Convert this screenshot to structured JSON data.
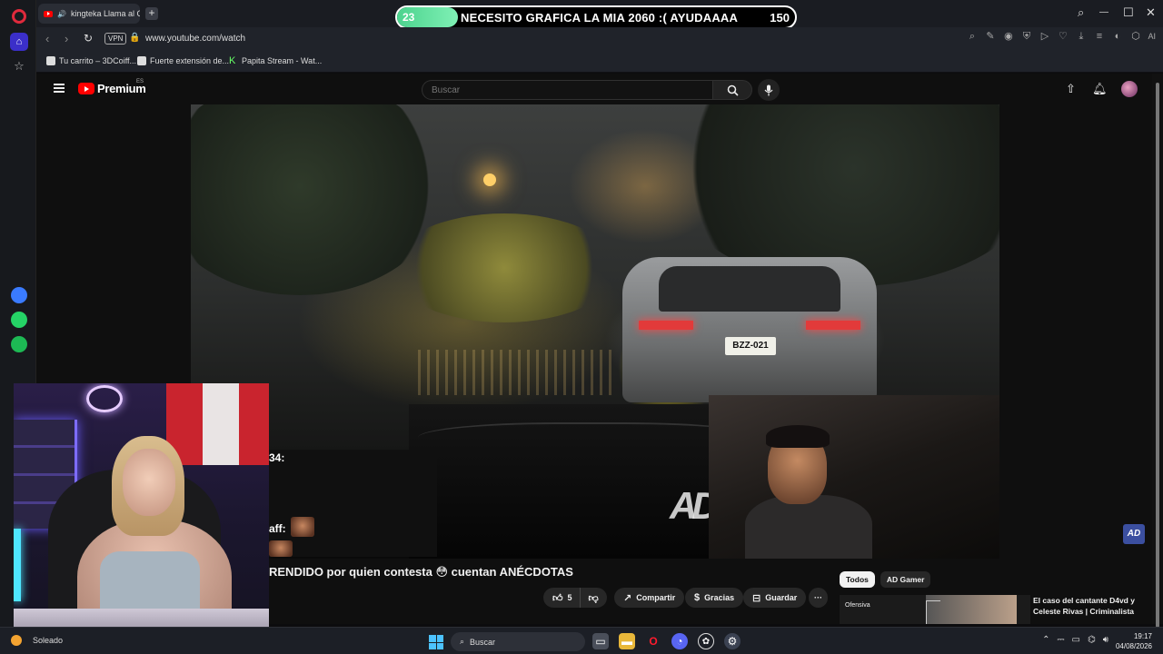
{
  "browser": {
    "tab_title": "kingteka Llama al CEV",
    "new_tab": "+",
    "url": "www.youtube.com/watch",
    "vpn_label": "VPN",
    "ai_label": "AI",
    "window_controls": {
      "search": "⌕",
      "minimize": "—",
      "maximize": "☐",
      "close": "✕"
    },
    "bookmarks": [
      {
        "label": "Tu carrito – 3DCoiff...",
        "icon": "page-icon"
      },
      {
        "label": "Fuerte extensión de...",
        "icon": "page-icon"
      },
      {
        "label": "Papita Stream - Wat...",
        "icon": "kick-icon"
      }
    ]
  },
  "overlay_banner": {
    "progress_low": "23",
    "progress_high": "150",
    "progress_fraction": 0.153,
    "message": "NECESITO GRAFICA LA MIA 2060 :( AYUDAAAA"
  },
  "youtube": {
    "brand": "Premium",
    "region": "ES",
    "search_placeholder": "Buscar",
    "video": {
      "plate_text": "BZZ-021",
      "watermark": "AD",
      "channel_badge": "AD",
      "title": "RENDIDO por quien contesta 😳 cuentan ANÉCDOTAS"
    },
    "actions": {
      "likes": "5",
      "share": "Compartir",
      "thanks": "Gracias",
      "save": "Guardar",
      "more": "···"
    },
    "chips": [
      "Todos",
      "AD Gamer"
    ],
    "recommendation": {
      "thumb_text": "Ofensiva",
      "title": "El caso del cantante D4vd y Celeste Rivas | Criminalista"
    }
  },
  "chat_fragment": {
    "line1": "34:",
    "line2": "aff:"
  },
  "taskbar": {
    "weather": "Soleado",
    "search_label": "Buscar",
    "time": "19:17",
    "date": "04/08/2026"
  }
}
